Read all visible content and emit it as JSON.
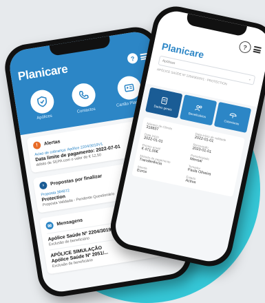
{
  "left_phone": {
    "brand": "Planicare",
    "help_icon_label": "?",
    "quick_actions": [
      {
        "label": "Apólices",
        "icon": "shield-icon"
      },
      {
        "label": "Contactos",
        "icon": "phone-icon"
      },
      {
        "label": "Cartão Planicare",
        "icon": "card-icon"
      }
    ],
    "alerts": {
      "title": "Alertas",
      "link": "Aviso de cobrança: Apólice 2204/3019V1",
      "strong": "Data limite de pagamento: 2022-07-01",
      "sub": "débito de SEPA com o valor de € 12,50"
    },
    "proposals": {
      "title": "Propostas por finalizar",
      "link": "Proposta 384872",
      "strong": "Protection",
      "sub": "Proposta Validada - Pendente Questionário"
    },
    "messages": {
      "title": "Mensagens",
      "items": [
        {
          "strong": "Apólice Saúde Nº 2204/3019V",
          "sub": "Exclusão de beneficiário"
        },
        {
          "strong": "APÓLICE SIMULAÇÃO",
          "strong2": "Apólice Saúde Nº 2051/...",
          "sub": "Exclusão de beneficiário"
        }
      ]
    }
  },
  "right_phone": {
    "brand": "Planicare",
    "help_icon_label": "?",
    "select_value": "Apólices",
    "subtitle": "APÓLICE SAÚDE Nº 2204/3019V1 - PROTECTION",
    "tabs": [
      {
        "label": "Dados gerais",
        "icon": "document-icon"
      },
      {
        "label": "Beneficiários",
        "icon": "users-icon"
      },
      {
        "label": "Coberturas",
        "icon": "umbrella-icon"
      }
    ],
    "details": [
      {
        "label": "Número de Cliente",
        "value": "318837"
      },
      {
        "label": "Data início de validade",
        "value": "2022-01-01"
      },
      {
        "label": "Data início",
        "value": "2022-01-01"
      },
      {
        "label": "Renovação",
        "value": "2023-01-01"
      },
      {
        "label": "Prémio anual",
        "value": "€ 471,00€"
      },
      {
        "label": "Periodicidade",
        "value": "Mensal"
      },
      {
        "label": "Método de pagamento",
        "value": "Transferência"
      },
      {
        "label": "Tomador",
        "value": "Paula Oliveira"
      },
      {
        "label": "Moeda",
        "value": "Euros"
      },
      {
        "label": "Estado",
        "value": "Activa"
      }
    ]
  },
  "colors": {
    "brand_blue": "#2c86c6",
    "accent_cyan": "#35c7d7",
    "alert_orange": "#e86b26"
  }
}
